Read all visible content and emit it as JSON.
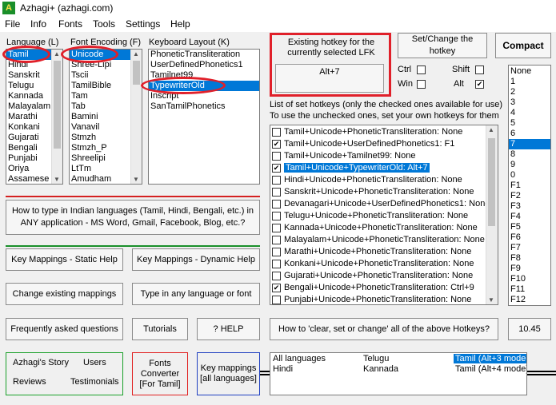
{
  "window": {
    "title": "Azhagi+ (azhagi.com)",
    "icon": "A"
  },
  "menu": [
    "File",
    "Info",
    "Fonts",
    "Tools",
    "Settings",
    "Help"
  ],
  "language": {
    "label": "Language (L)",
    "items": [
      "Tamil",
      "Hindi",
      "Sanskrit",
      "Telugu",
      "Kannada",
      "Malayalam",
      "Marathi",
      "Konkani",
      "Gujarati",
      "Bengali",
      "Punjabi",
      "Oriya",
      "Assamese"
    ]
  },
  "encoding": {
    "label": "Font Encoding (F)",
    "items": [
      "Unicode",
      "Shree-Lipi",
      "Tscii",
      "TamilBible",
      "Tam",
      "Tab",
      "Bamini",
      "Vanavil",
      "Stmzh",
      "Stmzh_P",
      "Shreelipi",
      "LtTm",
      "Amudham"
    ]
  },
  "keyboard": {
    "label": "Keyboard Layout (K)",
    "items": [
      "PhoneticTransliteration",
      "UserDefinedPhonetics1",
      "Tamilnet99",
      "TypewriterOld",
      "Inscript",
      "SanTamilPhonetics"
    ]
  },
  "hotkey_panel": {
    "title": "Existing hotkey for the currently selected LFK",
    "value": "Alt+7",
    "set_button": "Set/Change the hotkey",
    "compact_button": "Compact",
    "ctrl": "Ctrl",
    "shift": "Shift",
    "win": "Win",
    "alt": "Alt"
  },
  "set_hotkeys": {
    "line1": "List of set hotkeys (only the checked ones available for use)",
    "line2": "To use the unchecked ones, set your own hotkeys for them",
    "items": [
      {
        "text": "Tamil+Unicode+PhoneticTransliteration: None",
        "checked": ""
      },
      {
        "text": "Tamil+Unicode+UserDefinedPhonetics1: F1",
        "checked": "✔"
      },
      {
        "text": "Tamil+Unicode+Tamilnet99: None",
        "checked": ""
      },
      {
        "text": "Tamil+Unicode+TypewriterOld: Alt+7",
        "checked": "✔"
      },
      {
        "text": "Hindi+Unicode+PhoneticTransliteration: None",
        "checked": ""
      },
      {
        "text": "Sanskrit+Unicode+PhoneticTransliteration: None",
        "checked": ""
      },
      {
        "text": "Devanagari+Unicode+UserDefinedPhonetics1: None",
        "checked": ""
      },
      {
        "text": "Telugu+Unicode+PhoneticTransliteration: None",
        "checked": ""
      },
      {
        "text": "Kannada+Unicode+PhoneticTransliteration: None",
        "checked": ""
      },
      {
        "text": "Malayalam+Unicode+PhoneticTransliteration: None",
        "checked": ""
      },
      {
        "text": "Marathi+Unicode+PhoneticTransliteration: None",
        "checked": ""
      },
      {
        "text": "Konkani+Unicode+PhoneticTransliteration: None",
        "checked": ""
      },
      {
        "text": "Gujarati+Unicode+PhoneticTransliteration: None",
        "checked": ""
      },
      {
        "text": "Bengali+Unicode+PhoneticTransliteration: Ctrl+9",
        "checked": "✔"
      },
      {
        "text": "Punjabi+Unicode+PhoneticTransliteration: None",
        "checked": ""
      }
    ]
  },
  "keys_list": [
    "None",
    "1",
    "2",
    "3",
    "4",
    "5",
    "6",
    "7",
    "8",
    "9",
    "0",
    "F1",
    "F2",
    "F3",
    "F4",
    "F5",
    "F6",
    "F7",
    "F8",
    "F9",
    "F10",
    "F11",
    "F12"
  ],
  "buttons": {
    "how_to_type": "How to type in Indian languages (Tamil, Hindi, Bengali, etc.) in ANY application - MS Word, Gmail, Facebook, Blog, etc.?",
    "static_help": "Key Mappings - Static Help",
    "dynamic_help": "Key Mappings - Dynamic Help",
    "change_mappings": "Change existing mappings",
    "type_any": "Type in any language or font",
    "faq": "Frequently asked questions",
    "tutorials": "Tutorials",
    "help": "?  HELP",
    "how_to_hotkeys": "How to 'clear, set or change' all of the above Hotkeys?",
    "version": "10.45",
    "story": "Azhagi's Story",
    "users": "Users",
    "reviews": "Reviews",
    "testimonials": "Testimonials",
    "fonts_converter": "Fonts Converter [For Tamil]",
    "key_mappings_all": "Key mappings [all languages]"
  },
  "modes": [
    {
      "a": "All languages",
      "b": "Telugu",
      "c": "Tamil (Alt+3 mode)"
    },
    {
      "a": "Hindi",
      "b": "Kannada",
      "c": "Tamil (Alt+4 mode)"
    }
  ]
}
